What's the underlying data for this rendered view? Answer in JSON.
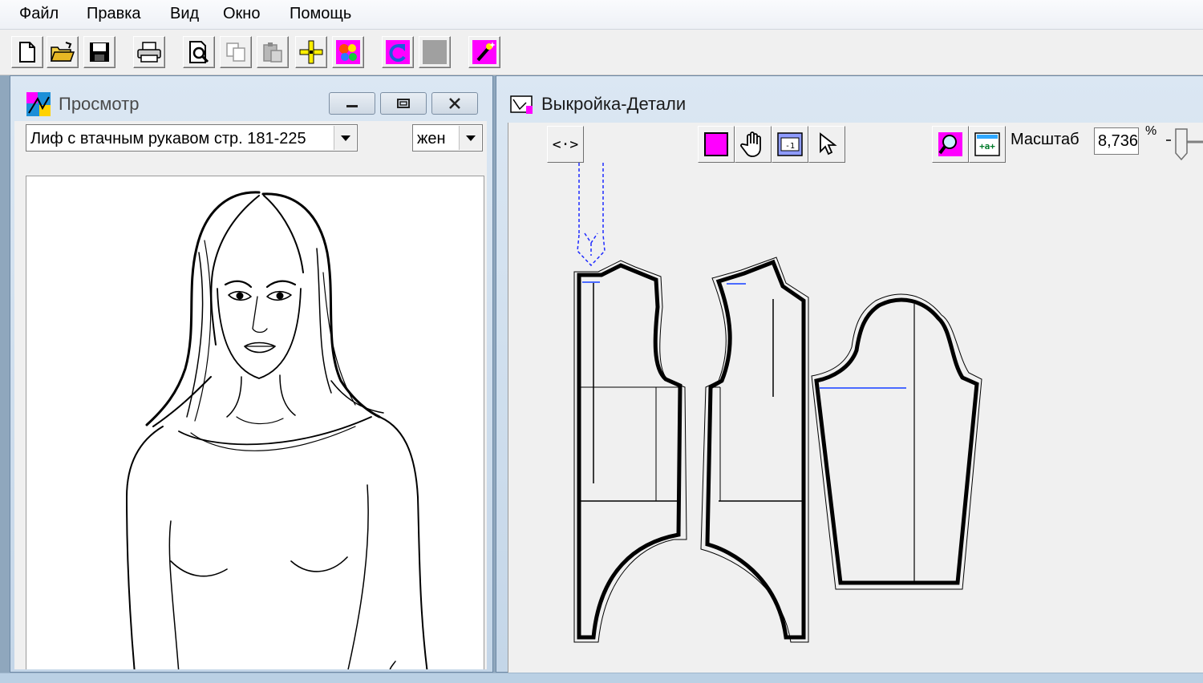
{
  "menu": {
    "file": "Файл",
    "edit": "Правка",
    "view": "Вид",
    "window": "Окно",
    "help": "Помощь"
  },
  "toolbar": {
    "buttons": [
      "new-doc-icon",
      "open-folder-icon",
      "save-disk-icon",
      "printer-icon",
      "print-preview-icon",
      "copy-icon",
      "paste-icon",
      "crosshair-yellow-icon",
      "color-palette-icon",
      "undo-magenta-icon",
      "gray-square-icon",
      "magic-wand-icon"
    ]
  },
  "preview_window": {
    "title": "Просмотр",
    "model_select": "Лиф с втачным рукавом стр. 181-225",
    "gender_select": "жен"
  },
  "pattern_window": {
    "title": "Выкройка-Детали",
    "toggle_label": "<·>",
    "scale_label": "Масштаб",
    "scale_value": "8,736",
    "percent_sign": "%"
  },
  "colors": {
    "accent_magenta": "#ff00ff",
    "pattern_blue": "#0000ff",
    "title_bar": "#c4d6e8"
  }
}
